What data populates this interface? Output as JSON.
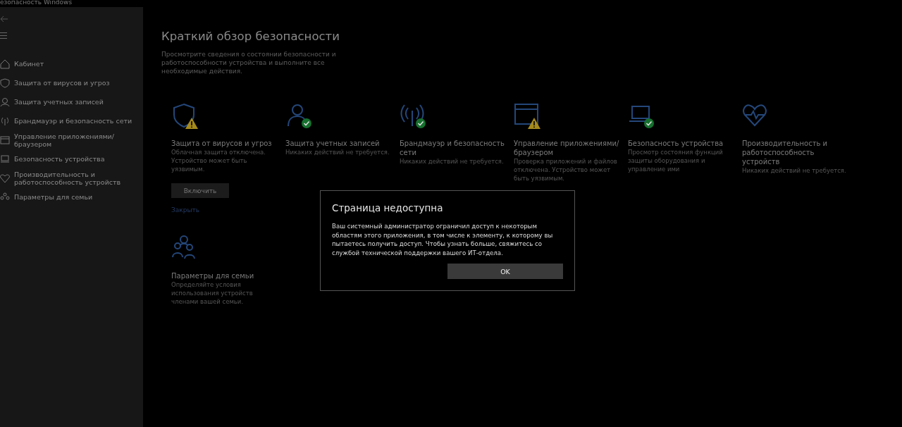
{
  "window": {
    "title": "езопасность Windows"
  },
  "sidebar": {
    "items": [
      {
        "label": "Кабинет",
        "kind": "home"
      },
      {
        "label": "Защита от вирусов и угроз",
        "kind": "shield"
      },
      {
        "label": "Защита учетных записей",
        "kind": "person"
      },
      {
        "label": "Брандмауэр и безопасность сети",
        "kind": "antenna"
      },
      {
        "label": "Управление приложениями/браузером",
        "kind": "window"
      },
      {
        "label": "Безопасность устройства",
        "kind": "laptop"
      },
      {
        "label": "Производительность и работоспособность устройств",
        "kind": "heart"
      },
      {
        "label": "Параметры для семьи",
        "kind": "family"
      }
    ]
  },
  "main": {
    "title": "Краткий обзор безопасности",
    "subtitle": "Просмотрите сведения о состоянии безопасности и работоспособности устройства и выполните все необходимые действия.",
    "cards": [
      {
        "kind": "shield",
        "warning": true,
        "protected": false,
        "title": "Защита от вирусов и угроз",
        "description": "Облачная защита отключена. Устройство может быть уязвимым.",
        "button": "Включить",
        "link": "Закрыть"
      },
      {
        "kind": "person",
        "warning": false,
        "protected": true,
        "title": "Защита учетных записей",
        "description": "Никаких действий не требуется."
      },
      {
        "kind": "antenna",
        "warning": false,
        "protected": true,
        "title": "Брандмауэр и безопасность сети",
        "description": "Никаких действий не требуется."
      },
      {
        "kind": "window",
        "warning": true,
        "protected": false,
        "title": "Управление приложениями/браузером",
        "description": "Проверка приложений и файлов отключена. Устройство может быть уязвимым."
      },
      {
        "kind": "laptop",
        "warning": false,
        "protected": true,
        "title": "Безопасность устройства",
        "description": "Просмотр состояния функций защиты оборудования и управление ими"
      },
      {
        "kind": "heart",
        "warning": false,
        "protected": false,
        "title": "Производительность и работоспособность устройств",
        "description": "Никаких действий не требуется."
      },
      {
        "kind": "family",
        "warning": false,
        "protected": false,
        "title": "Параметры для семьи",
        "description": "Определяйте условия использования устройств членами вашей семьи."
      }
    ]
  },
  "dialog": {
    "title": "Страница недоступна",
    "message": "Ваш системный администратор ограничил доступ к некоторым областям этого приложения, в том числе к элементу, к которому вы пытаетесь получить доступ. Чтобы узнать больше, свяжитесь со службой технической поддержки вашего ИТ-отдела.",
    "button": "OK"
  }
}
